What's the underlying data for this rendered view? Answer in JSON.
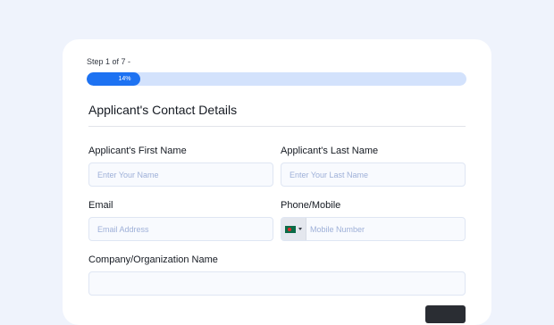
{
  "form": {
    "step_text": "Step 1 of 7 -",
    "progress": {
      "label": "14%",
      "value": 0.14
    },
    "section_title": "Applicant's Contact Details",
    "fields": {
      "first_name": {
        "label": "Applicant's First Name",
        "value": "",
        "placeholder": "Enter Your Name"
      },
      "last_name": {
        "label": "Applicant's Last Name",
        "value": "",
        "placeholder": "Enter Your Last Name"
      },
      "email": {
        "label": "Email",
        "value": "",
        "placeholder": "Email Address"
      },
      "phone": {
        "label": "Phone/Mobile",
        "value": "",
        "placeholder": "Mobile Number",
        "country_flag": "bangladesh-flag-icon"
      },
      "company": {
        "label": "Company/Organization Name",
        "value": "",
        "placeholder": ""
      }
    }
  },
  "colors": {
    "page_bg": "#eff3fc",
    "card_bg": "#ffffff",
    "accent": "#1d72f2",
    "progress_track": "#d3e2fc",
    "button_dark": "#2a2d33"
  }
}
